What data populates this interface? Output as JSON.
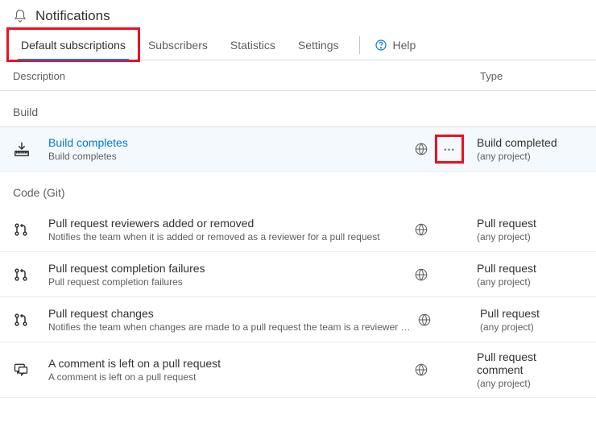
{
  "header": {
    "title": "Notifications"
  },
  "tabs": {
    "t0": "Default subscriptions",
    "t1": "Subscribers",
    "t2": "Statistics",
    "t3": "Settings",
    "help": "Help"
  },
  "columns": {
    "description": "Description",
    "type": "Type"
  },
  "sections": {
    "build": {
      "title": "Build",
      "r0": {
        "title": "Build completes",
        "sub": "Build completes",
        "type": "Build completed",
        "scope": "(any project)"
      }
    },
    "code_git": {
      "title": "Code (Git)",
      "r0": {
        "title": "Pull request reviewers added or removed",
        "sub": "Notifies the team when it is added or removed as a reviewer for a pull request",
        "type": "Pull request",
        "scope": "(any project)"
      },
      "r1": {
        "title": "Pull request completion failures",
        "sub": "Pull request completion failures",
        "type": "Pull request",
        "scope": "(any project)"
      },
      "r2": {
        "title": "Pull request changes",
        "sub": "Notifies the team when changes are made to a pull request the team is a reviewer for",
        "type": "Pull request",
        "scope": "(any project)"
      },
      "r3": {
        "title": "A comment is left on a pull request",
        "sub": "A comment is left on a pull request",
        "type": "Pull request comment",
        "scope": "(any project)"
      }
    }
  }
}
